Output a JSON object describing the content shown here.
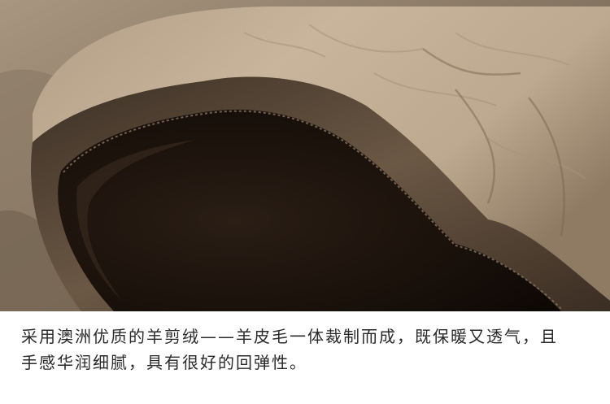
{
  "image": {
    "subject": "rolled sheepskin-style rug edge",
    "colors": {
      "fur_light": "#c7b39a",
      "fur_mid": "#9e8a72",
      "fur_dark": "#4a3c2e",
      "backing": "#1c130d",
      "background": "#8a7a66"
    }
  },
  "caption": {
    "line1": "采用澳洲优质的羊剪绒——羊皮毛一体裁制而成，既保暖又透气，且",
    "line2": "手感华润细腻，具有很好的回弹性。"
  }
}
